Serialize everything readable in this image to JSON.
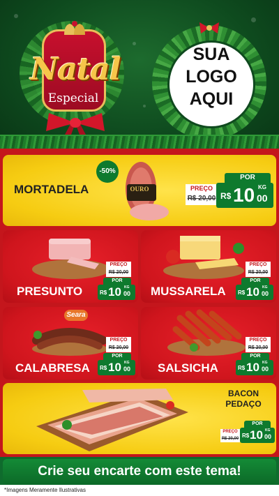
{
  "header": {
    "title": "Natal",
    "subtitle": "Especial",
    "logo_lines": [
      "SUA",
      "LOGO",
      "AQUI"
    ]
  },
  "products": [
    {
      "name": "MORTADELA",
      "badge": "-50%",
      "brand": "OURO",
      "por": "POR",
      "preco": "PREÇO",
      "old_price": "R$ 20,00",
      "currency": "R$",
      "price": "10",
      "cents": "00",
      "unit": "KG"
    },
    {
      "name": "PRESUNTO",
      "por": "POR",
      "preco": "PREÇO",
      "old_price": "R$ 20,00",
      "currency": "R$",
      "price": "10",
      "cents": "00",
      "unit": "KG"
    },
    {
      "name": "MUSSARELA",
      "por": "POR",
      "preco": "PREÇO",
      "old_price": "R$ 20,00",
      "currency": "R$",
      "price": "10",
      "cents": "00",
      "unit": "KG"
    },
    {
      "name": "CALABRESA",
      "brand": "Seara",
      "por": "POR",
      "preco": "PREÇO",
      "old_price": "R$ 20,00",
      "currency": "R$",
      "price": "10",
      "cents": "00",
      "unit": "KG"
    },
    {
      "name": "SALSICHA",
      "por": "POR",
      "preco": "PREÇO",
      "old_price": "R$ 20,00",
      "currency": "R$",
      "price": "10",
      "cents": "00",
      "unit": "KG"
    },
    {
      "name_lines": [
        "BACON",
        "PEDAÇO"
      ],
      "por": "POR",
      "preco": "PREÇO",
      "old_price": "R$ 20,00",
      "currency": "R$",
      "price": "10",
      "cents": "00",
      "unit": "KG"
    }
  ],
  "footer": {
    "cta": "Crie seu encarte com este tema!",
    "disclaimer": "*Imagens Meramente Ilustrativas"
  },
  "colors": {
    "green": "#0e7a2e",
    "red": "#c4161c",
    "yellow": "#f6cc12",
    "gold": "#f6c54a"
  }
}
